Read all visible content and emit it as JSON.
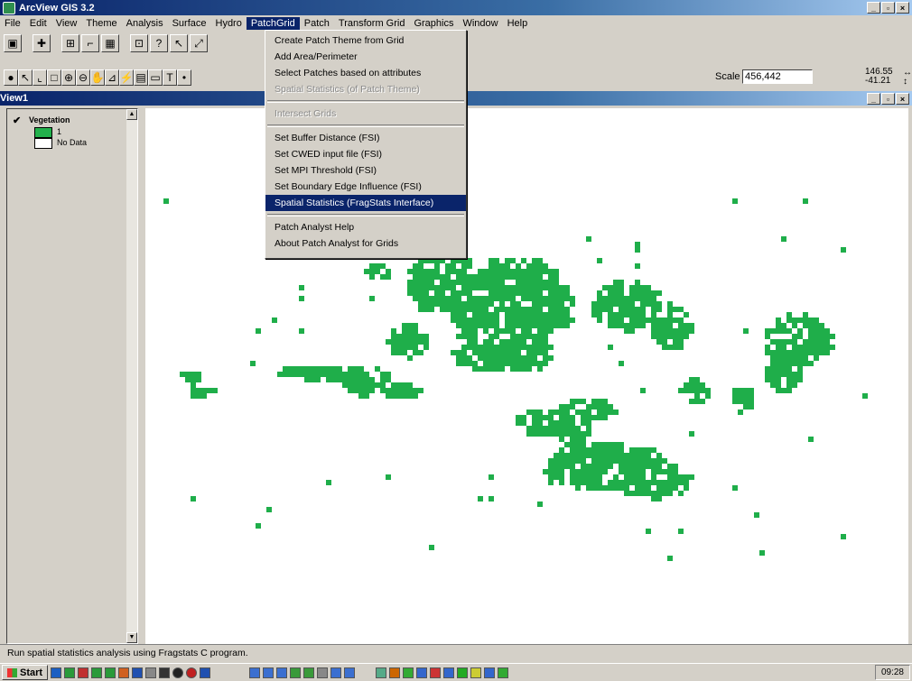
{
  "app": {
    "title": "ArcView GIS 3.2",
    "window_buttons": [
      "_",
      "▫",
      "×"
    ]
  },
  "menubar": {
    "items": [
      {
        "label": "File"
      },
      {
        "label": "Edit"
      },
      {
        "label": "View"
      },
      {
        "label": "Theme"
      },
      {
        "label": "Analysis"
      },
      {
        "label": "Surface"
      },
      {
        "label": "Hydro"
      },
      {
        "label": "PatchGrid"
      },
      {
        "label": "Patch"
      },
      {
        "label": "Transform Grid"
      },
      {
        "label": "Graphics"
      },
      {
        "label": "Window"
      },
      {
        "label": "Help"
      }
    ],
    "active": "PatchGrid"
  },
  "patchgrid_menu": {
    "items": [
      {
        "label": "Create Patch Theme from Grid",
        "state": "normal"
      },
      {
        "label": "Add Area/Perimeter",
        "state": "normal"
      },
      {
        "label": "Select Patches based on attributes",
        "state": "normal"
      },
      {
        "label": "Spatial Statistics (of Patch Theme)",
        "state": "disabled"
      },
      {
        "separator": true
      },
      {
        "label": "Intersect Grids",
        "state": "disabled"
      },
      {
        "separator": true
      },
      {
        "label": "Set Buffer Distance (FSI)",
        "state": "normal"
      },
      {
        "label": "Set CWED input file (FSI)",
        "state": "normal"
      },
      {
        "label": "Set MPI Threshold (FSI)",
        "state": "normal"
      },
      {
        "label": "Set Boundary Edge Influence (FSI)",
        "state": "normal"
      },
      {
        "label": "Spatial Statistics (FragStats Interface)",
        "state": "selected"
      },
      {
        "separator": true
      },
      {
        "label": "Patch Analyst Help",
        "state": "normal"
      },
      {
        "label": "About Patch Analyst for Grids",
        "state": "normal"
      }
    ]
  },
  "scale": {
    "label": "Scale 1:",
    "value": "456,442"
  },
  "coordinates": {
    "x": "146.55",
    "y": "-41.21"
  },
  "view": {
    "title": "View1"
  },
  "toc": {
    "theme_name": "Vegetation",
    "checked": true,
    "legend": [
      {
        "label": "1",
        "color": "#22b14c"
      },
      {
        "label": "No Data",
        "color": "#ffffff"
      }
    ]
  },
  "map": {
    "patch_color": "#1fae4a"
  },
  "status": {
    "text": "Run spatial statistics analysis using Fragstats C program."
  },
  "taskbar": {
    "start_label": "Start",
    "clock": "09:28"
  }
}
